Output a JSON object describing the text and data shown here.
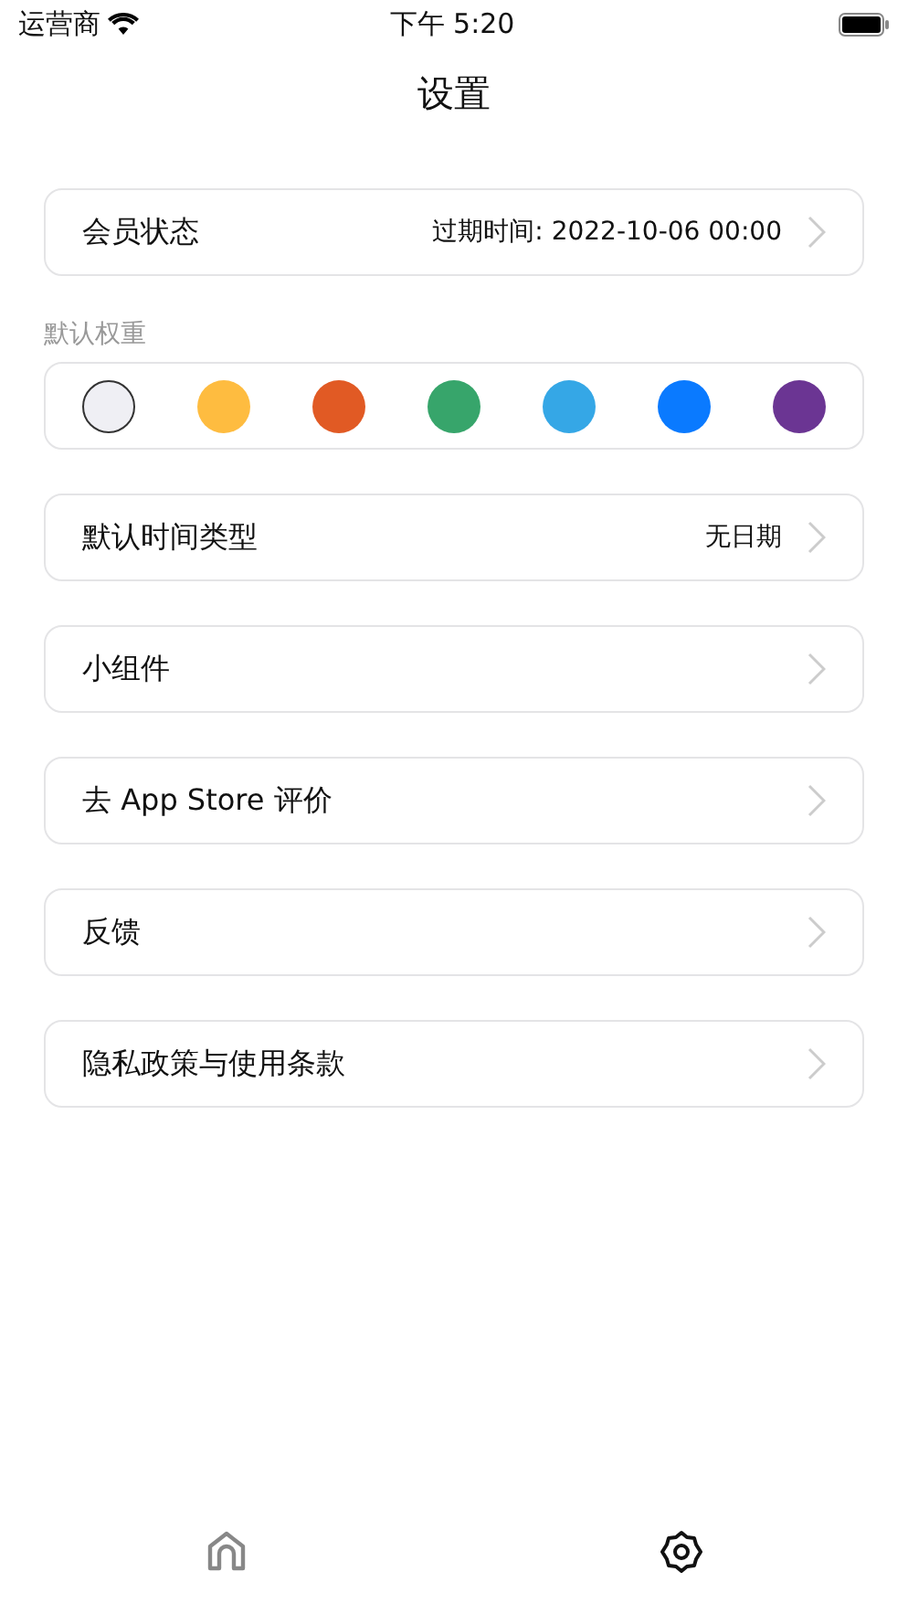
{
  "status_bar": {
    "carrier": "运营商",
    "time": "下午 5:20"
  },
  "title": "设置",
  "membership": {
    "label": "会员状态",
    "value": "过期时间: 2022-10-06 00:00"
  },
  "weight": {
    "label": "默认权重",
    "colors": [
      {
        "color": "#efeff4",
        "selected": true
      },
      {
        "color": "#febc40",
        "selected": false
      },
      {
        "color": "#e15a24",
        "selected": false
      },
      {
        "color": "#37a56b",
        "selected": false
      },
      {
        "color": "#35a7e6",
        "selected": false
      },
      {
        "color": "#0a7aff",
        "selected": false
      },
      {
        "color": "#6b3593",
        "selected": false
      }
    ]
  },
  "rows": [
    {
      "label": "默认时间类型",
      "value": "无日期"
    },
    {
      "label": "小组件"
    },
    {
      "label": "去 App Store 评价"
    },
    {
      "label": "反馈"
    },
    {
      "label": "隐私政策与使用条款"
    }
  ],
  "tabs": [
    {
      "kind": "home",
      "selected": false
    },
    {
      "kind": "settings",
      "selected": true
    }
  ]
}
